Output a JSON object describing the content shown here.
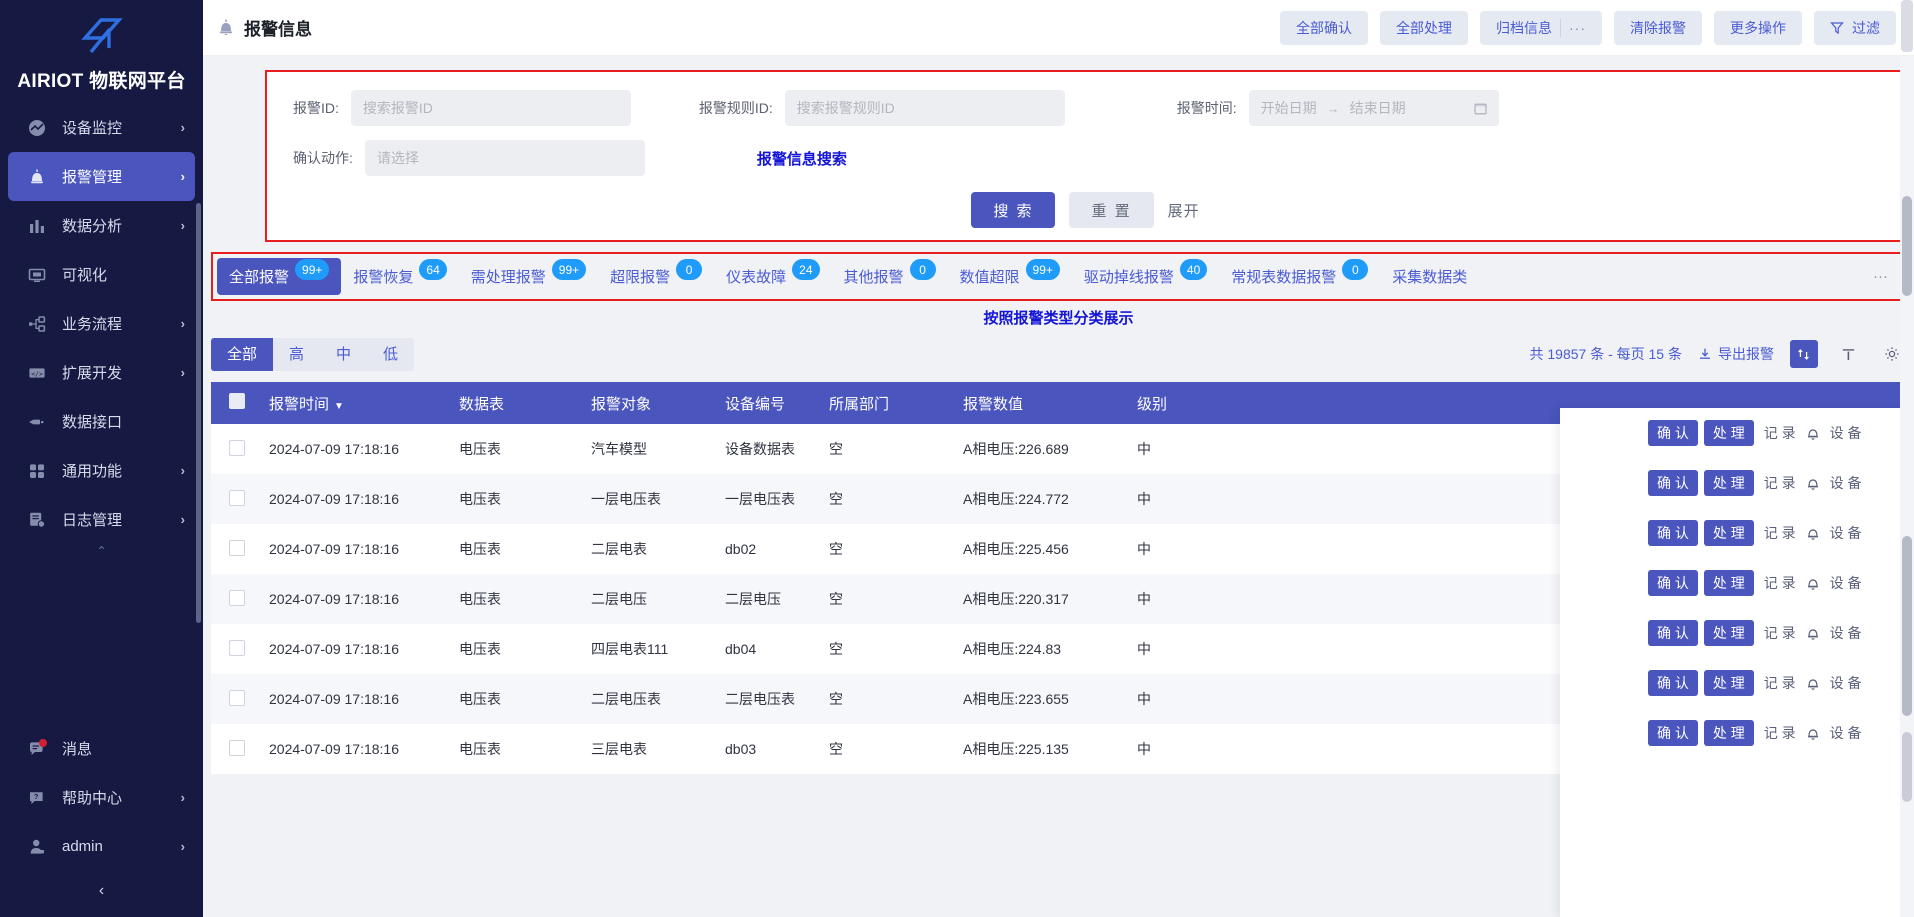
{
  "brand": {
    "name": "AIRIOT 物联网平台",
    "logo_icon": "airiot-logo-icon"
  },
  "sidebar": {
    "items": [
      {
        "label": "设备监控",
        "icon": "monitor-icon",
        "arrow": "›",
        "active": false
      },
      {
        "label": "报警管理",
        "icon": "alarm-bell-icon",
        "arrow": "›",
        "active": true
      },
      {
        "label": "数据分析",
        "icon": "bar-chart-icon",
        "arrow": "›",
        "active": false
      },
      {
        "label": "可视化",
        "icon": "screen-icon",
        "arrow": "",
        "active": false
      },
      {
        "label": "业务流程",
        "icon": "flow-icon",
        "arrow": "›",
        "active": false
      },
      {
        "label": "扩展开发",
        "icon": "code-icon",
        "arrow": "›",
        "active": false
      },
      {
        "label": "数据接口",
        "icon": "plug-icon",
        "arrow": "",
        "active": false
      },
      {
        "label": "通用功能",
        "icon": "grid-icon",
        "arrow": "›",
        "active": false
      },
      {
        "label": "日志管理",
        "icon": "log-icon",
        "arrow": "›",
        "active": false
      }
    ],
    "bottom_items": [
      {
        "label": "消息",
        "icon": "message-icon",
        "arrow": "",
        "dot": true
      },
      {
        "label": "帮助中心",
        "icon": "help-icon",
        "arrow": "›",
        "dot": false
      },
      {
        "label": "admin",
        "icon": "user-icon",
        "arrow": "›",
        "dot": false
      }
    ],
    "collapse_icon": "chevron-left-icon"
  },
  "header": {
    "title": "报警信息",
    "title_icon": "bell-icon",
    "actions": [
      {
        "label": "全部确认"
      },
      {
        "label": "全部处理"
      },
      {
        "label": "归档信息",
        "extra": "···"
      },
      {
        "label": "清除报警"
      },
      {
        "label": "更多操作"
      },
      {
        "label": "过滤",
        "icon": "filter-icon"
      }
    ]
  },
  "search_form": {
    "annotation": "报警信息搜索",
    "fields": [
      {
        "label": "报警ID:",
        "placeholder": "搜索报警ID",
        "value": ""
      },
      {
        "label": "报警规则ID:",
        "placeholder": "搜索报警规则ID",
        "value": ""
      },
      {
        "label": "报警时间:",
        "start_placeholder": "开始日期",
        "end_placeholder": "结束日期",
        "range_arrow": "→",
        "calendar_icon": "calendar-icon"
      },
      {
        "label": "确认动作:",
        "placeholder": "请选择",
        "value": ""
      }
    ],
    "buttons": {
      "search": "搜 索",
      "reset": "重 置",
      "expand": "展开"
    }
  },
  "tabs": {
    "annotation": "按照报警类型分类展示",
    "more_icon": "···",
    "items": [
      {
        "label": "全部报警",
        "badge": "99+",
        "active": true
      },
      {
        "label": "报警恢复",
        "badge": "64",
        "active": false
      },
      {
        "label": "需处理报警",
        "badge": "99+",
        "active": false
      },
      {
        "label": "超限报警",
        "badge": "0",
        "active": false
      },
      {
        "label": "仪表故障",
        "badge": "24",
        "active": false
      },
      {
        "label": "其他报警",
        "badge": "0",
        "active": false
      },
      {
        "label": "数值超限",
        "badge": "99+",
        "active": false
      },
      {
        "label": "驱动掉线报警",
        "badge": "40",
        "active": false
      },
      {
        "label": "常规表数据报警",
        "badge": "0",
        "active": false
      },
      {
        "label": "采集数据类",
        "badge": "",
        "active": false
      }
    ]
  },
  "list_toolbar": {
    "levels": [
      {
        "label": "全部",
        "active": true
      },
      {
        "label": "高",
        "active": false
      },
      {
        "label": "中",
        "active": false
      },
      {
        "label": "低",
        "active": false
      }
    ],
    "count_text": "共 19857 条 - 每页 15 条",
    "export_label": "导出报警",
    "export_icon": "download-icon",
    "sort_icon": "sort-icon",
    "column-icon": "columns-icon",
    "settings_icon": "gear-icon"
  },
  "table": {
    "columns": [
      "报警时间",
      "数据表",
      "报警对象",
      "设备编号",
      "所属部门",
      "报警数值",
      "级别"
    ],
    "sort_caret": "▼",
    "row_actions": {
      "confirm": "确 认",
      "handle": "处 理",
      "record": "记 录",
      "bell_icon": "bell-icon",
      "device": "设 备"
    },
    "rows": [
      {
        "time": "2024-07-09 17:18:16",
        "table": "电压表",
        "object": "汽车模型",
        "devno": "设备数据表",
        "dept": "空",
        "value": "A相电压:226.689",
        "level": "中"
      },
      {
        "time": "2024-07-09 17:18:16",
        "table": "电压表",
        "object": "一层电压表",
        "devno": "一层电压表",
        "dept": "空",
        "value": "A相电压:224.772",
        "level": "中"
      },
      {
        "time": "2024-07-09 17:18:16",
        "table": "电压表",
        "object": "二层电表",
        "devno": "db02",
        "dept": "空",
        "value": "A相电压:225.456",
        "level": "中"
      },
      {
        "time": "2024-07-09 17:18:16",
        "table": "电压表",
        "object": "二层电压",
        "devno": "二层电压",
        "dept": "空",
        "value": "A相电压:220.317",
        "level": "中"
      },
      {
        "time": "2024-07-09 17:18:16",
        "table": "电压表",
        "object": "四层电表111",
        "devno": "db04",
        "dept": "空",
        "value": "A相电压:224.83",
        "level": "中"
      },
      {
        "time": "2024-07-09 17:18:16",
        "table": "电压表",
        "object": "二层电压表",
        "devno": "二层电压表",
        "dept": "空",
        "value": "A相电压:223.655",
        "level": "中"
      },
      {
        "time": "2024-07-09 17:18:16",
        "table": "电压表",
        "object": "三层电表",
        "devno": "db03",
        "dept": "空",
        "value": "A相电压:225.135",
        "level": "中"
      }
    ]
  },
  "colors": {
    "sidebar_bg": "#161a43",
    "accent": "#4a55bd",
    "badge": "#1f9bfa",
    "annotation_red": "#e81d1d",
    "annotation_blue": "#1414d6"
  }
}
